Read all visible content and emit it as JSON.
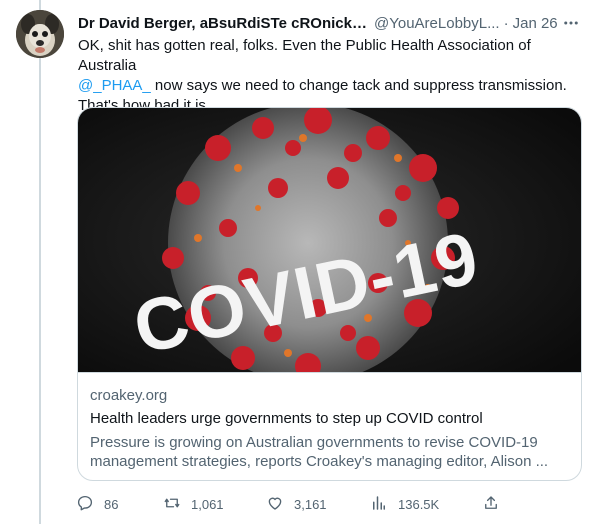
{
  "tweet": {
    "display_name": "Dr David Berger, aBsuRdiSTe cROnickL...",
    "handle": "@YouAreLobbyL...",
    "separator": "·",
    "date": "Jan 26",
    "text_part1": "OK, shit has gotten real, folks. Even the Public Health Association of Australia\n",
    "mention": "@_PHAA_",
    "text_part2": " now says we need to change tack and suppress transmission.\nThat's how bad it is."
  },
  "card": {
    "image_text": "COVID-19",
    "domain": "croakey.org",
    "title": "Health leaders urge governments to step up COVID control",
    "description": "Pressure is growing on Australian governments to revise COVID-19 management strategies, reports Croakey's managing editor, Alison ..."
  },
  "actions": {
    "replies": "86",
    "retweets": "1,061",
    "likes": "3,161",
    "views": "136.5K"
  },
  "colors": {
    "accent": "#1d9bf0",
    "muted": "#536471",
    "border": "#cfd9de",
    "virus_red": "#c8202a"
  },
  "icons": [
    "more-icon",
    "reply-icon",
    "retweet-icon",
    "like-icon",
    "views-icon",
    "share-icon"
  ]
}
